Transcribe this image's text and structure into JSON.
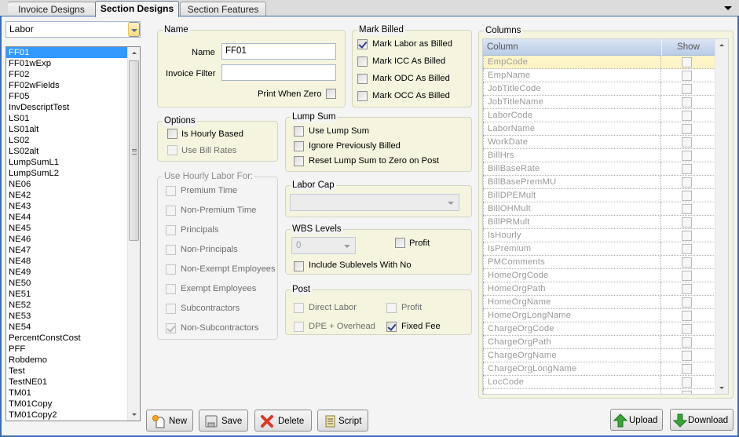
{
  "tabs": [
    {
      "label": "Invoice Designs",
      "active": false
    },
    {
      "label": "Section Designs",
      "active": true
    },
    {
      "label": "Section Features",
      "active": false
    }
  ],
  "section_type": {
    "value": "Labor"
  },
  "designs": {
    "selected": "FF01",
    "items": [
      "FF01",
      "FF01wExp",
      "FF02",
      "FF02wFields",
      "FF05",
      "InvDescriptTest",
      "LS01",
      "LS01alt",
      "LS02",
      "LS02alt",
      "LumpSumL1",
      "LumpSumL2",
      "NE06",
      "NE42",
      "NE43",
      "NE44",
      "NE45",
      "NE46",
      "NE47",
      "NE48",
      "NE49",
      "NE50",
      "NE51",
      "NE52",
      "NE53",
      "NE54",
      "PercentConstCost",
      "PFF",
      "Robdemo",
      "Test",
      "TestNE01",
      "TM01",
      "TM01Copy",
      "TM01Copy2"
    ]
  },
  "name_group": {
    "legend": "Name",
    "name_label": "Name",
    "name_value": "FF01",
    "filter_label": "Invoice Filter",
    "filter_value": "",
    "print_zero_label": "Print When Zero",
    "print_zero_checked": false
  },
  "mark_billed": {
    "legend": "Mark Billed",
    "items": [
      {
        "label": "Mark Labor as Billed",
        "checked": true
      },
      {
        "label": "Mark ICC As Billed",
        "checked": false
      },
      {
        "label": "Mark ODC As Billed",
        "checked": false
      },
      {
        "label": "Mark OCC As Billed",
        "checked": false
      }
    ]
  },
  "options": {
    "legend": "Options",
    "items": [
      {
        "label": "Is Hourly Based",
        "checked": false,
        "enabled": true
      },
      {
        "label": "Use Bill Rates",
        "checked": false,
        "enabled": false
      }
    ]
  },
  "hourly_labor": {
    "legend": "Use Hourly Labor For:",
    "items": [
      {
        "label": "Premium Time",
        "checked": false
      },
      {
        "label": "Non-Premium Time",
        "checked": false
      },
      {
        "label": "Principals",
        "checked": false
      },
      {
        "label": "Non-Principals",
        "checked": false
      },
      {
        "label": "Non-Exempt Employees",
        "checked": false
      },
      {
        "label": "Exempt Employees",
        "checked": false
      },
      {
        "label": "Subcontractors",
        "checked": false
      },
      {
        "label": "Non-Subcontractors",
        "checked": true
      }
    ]
  },
  "lump_sum": {
    "legend": "Lump Sum",
    "items": [
      {
        "label": "Use Lump Sum",
        "checked": false
      },
      {
        "label": "Ignore Previously Billed",
        "checked": false
      },
      {
        "label": "Reset Lump Sum to Zero on Post",
        "checked": false
      }
    ]
  },
  "labor_cap": {
    "legend": "Labor Cap",
    "value": ""
  },
  "wbs_levels": {
    "legend": "WBS Levels",
    "level_value": "0",
    "profit_label": "Profit",
    "profit_checked": false,
    "sublevels_label": "Include Sublevels With No",
    "sublevels_checked": false
  },
  "post": {
    "legend": "Post",
    "items": [
      {
        "label": "Direct Labor",
        "checked": false,
        "enabled": false
      },
      {
        "label": "Profit",
        "checked": false,
        "enabled": false
      },
      {
        "label": "DPE + Overhead",
        "checked": false,
        "enabled": false
      },
      {
        "label": "Fixed Fee",
        "checked": true,
        "enabled": true
      }
    ]
  },
  "columns": {
    "legend": "Columns",
    "headers": {
      "column": "Column",
      "show": "Show"
    },
    "rows": [
      {
        "name": "EmpCode",
        "show": false
      },
      {
        "name": "EmpName",
        "show": false
      },
      {
        "name": "JobTitleCode",
        "show": false
      },
      {
        "name": "JobTitleName",
        "show": false
      },
      {
        "name": "LaborCode",
        "show": false
      },
      {
        "name": "LaborName",
        "show": false
      },
      {
        "name": "WorkDate",
        "show": false
      },
      {
        "name": "BillHrs",
        "show": false
      },
      {
        "name": "BillBaseRate",
        "show": false
      },
      {
        "name": "BillBasePremMU",
        "show": false
      },
      {
        "name": "BillDPEMult",
        "show": false
      },
      {
        "name": "BillOHMult",
        "show": false
      },
      {
        "name": "BillPRMult",
        "show": false
      },
      {
        "name": "IsHourly",
        "show": false
      },
      {
        "name": "IsPremium",
        "show": false
      },
      {
        "name": "PMComments",
        "show": false
      },
      {
        "name": "HomeOrgCode",
        "show": false
      },
      {
        "name": "HomeOrgPath",
        "show": false
      },
      {
        "name": "HomeOrgName",
        "show": false
      },
      {
        "name": "HomeOrgLongName",
        "show": false
      },
      {
        "name": "ChargeOrgCode",
        "show": false
      },
      {
        "name": "ChargeOrgPath",
        "show": false
      },
      {
        "name": "ChargeOrgName",
        "show": false
      },
      {
        "name": "ChargeOrgLongName",
        "show": false
      },
      {
        "name": "LocCode",
        "show": false
      },
      {
        "name": "",
        "show": false
      }
    ]
  },
  "buttons": {
    "new": "New",
    "save": "Save",
    "delete": "Delete",
    "script": "Script",
    "upload": "Upload",
    "download": "Download"
  }
}
